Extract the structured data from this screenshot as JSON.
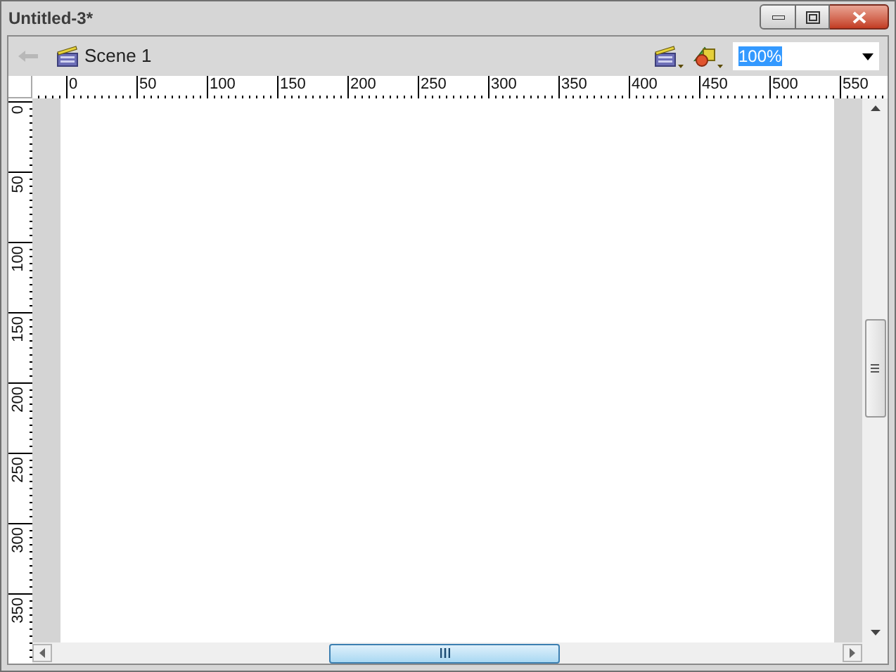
{
  "window": {
    "title": "Untitled-3*"
  },
  "toolbar": {
    "back_disabled": true,
    "scene": "Scene 1",
    "zoom": "100%"
  },
  "ruler": {
    "top_labels": [
      "0",
      "50",
      "100",
      "150",
      "200",
      "250",
      "300",
      "350",
      "400",
      "450",
      "500",
      "550"
    ],
    "left_labels": [
      "0",
      "50",
      "100",
      "150",
      "200",
      "250",
      "300",
      "350"
    ]
  }
}
